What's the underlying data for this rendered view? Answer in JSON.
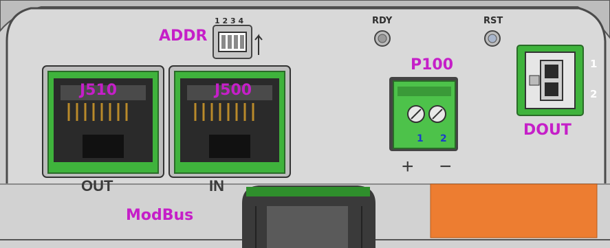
{
  "labels": {
    "addr": "ADDR",
    "dip_numbers": "1 2 3 4",
    "rdy": "RDY",
    "rst": "RST",
    "p100": "P100",
    "j510": "J510",
    "j500": "J500",
    "out": "OUT",
    "in": "IN",
    "modbus": "ModBus",
    "dout": "DOUT",
    "dout_pin1": "1",
    "dout_pin2": "2",
    "terminal_pin1": "1",
    "terminal_pin2": "2",
    "plus": "+",
    "minus": "−"
  },
  "colors": {
    "panel": "#d9d9d9",
    "panel_edge": "#4a4a4a",
    "connector_green": "#3fb33c",
    "terminal_green": "#4dc24a",
    "label_magenta": "#c51fc8",
    "label_blue": "#1a3cc9",
    "orange_block": "#ed7d31"
  }
}
